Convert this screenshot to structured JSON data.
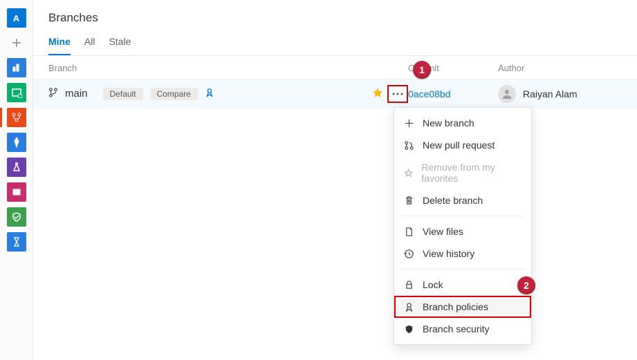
{
  "page": {
    "title": "Branches"
  },
  "leftnav": {
    "logo_letter": "A"
  },
  "tabs": {
    "mine": "Mine",
    "all": "All",
    "stale": "Stale"
  },
  "headers": {
    "branch": "Branch",
    "commit": "Commit",
    "author": "Author"
  },
  "row": {
    "branch_name": "main",
    "tag_default": "Default",
    "tag_compare": "Compare",
    "commit_hash": "0ace08bd",
    "author_name": "Raiyan Alam"
  },
  "menu": {
    "new_branch": "New branch",
    "new_pr": "New pull request",
    "remove_fav": "Remove from my favorites",
    "delete_branch": "Delete branch",
    "view_files": "View files",
    "view_history": "View history",
    "lock": "Lock",
    "branch_policies": "Branch policies",
    "branch_security": "Branch security"
  },
  "callouts": {
    "one": "1",
    "two": "2"
  }
}
